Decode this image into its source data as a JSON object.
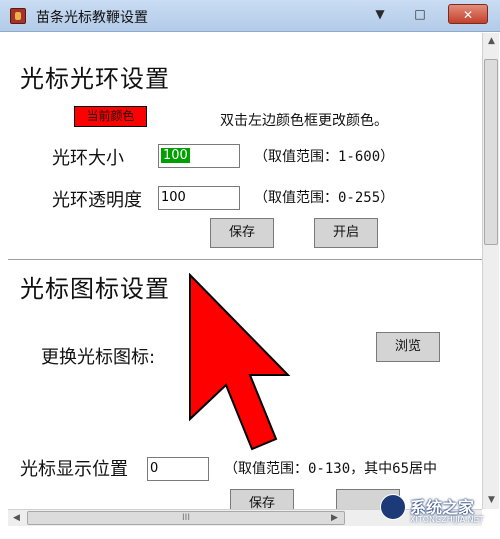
{
  "window": {
    "title": "苗条光标教鞭设置",
    "minimize_glyph": "▼",
    "maximize_glyph": "□",
    "close_glyph": "✕"
  },
  "halo": {
    "section_title": "光标光环设置",
    "current_color_label": "当前颜色",
    "current_color": "#ff0000",
    "color_hint": "双击左边颜色框更改颜色。",
    "size_label": "光环大小",
    "size_value": "100",
    "size_hint": "（取值范围：1-600）",
    "opacity_label": "光环透明度",
    "opacity_value": "100",
    "opacity_hint": "（取值范围：0-255）",
    "save_label": "保存",
    "enable_label": "开启"
  },
  "icon_settings": {
    "section_title": "光标图标设置",
    "change_icon_label": "更换光标图标:",
    "browse_label": "浏览",
    "cursor_icon": "red-arrow-cursor-icon",
    "cursor_color": "#ff0000"
  },
  "position": {
    "label": "光标显示位置",
    "value": "0",
    "hint": "（取值范围：0-130，其中65居中",
    "save_label": "保存",
    "second_button_label": ""
  },
  "scrollbars": {
    "hthumb_grip": "III"
  },
  "watermark": {
    "text": "系统之家",
    "url": "XITONGZHIJIA.NET"
  }
}
